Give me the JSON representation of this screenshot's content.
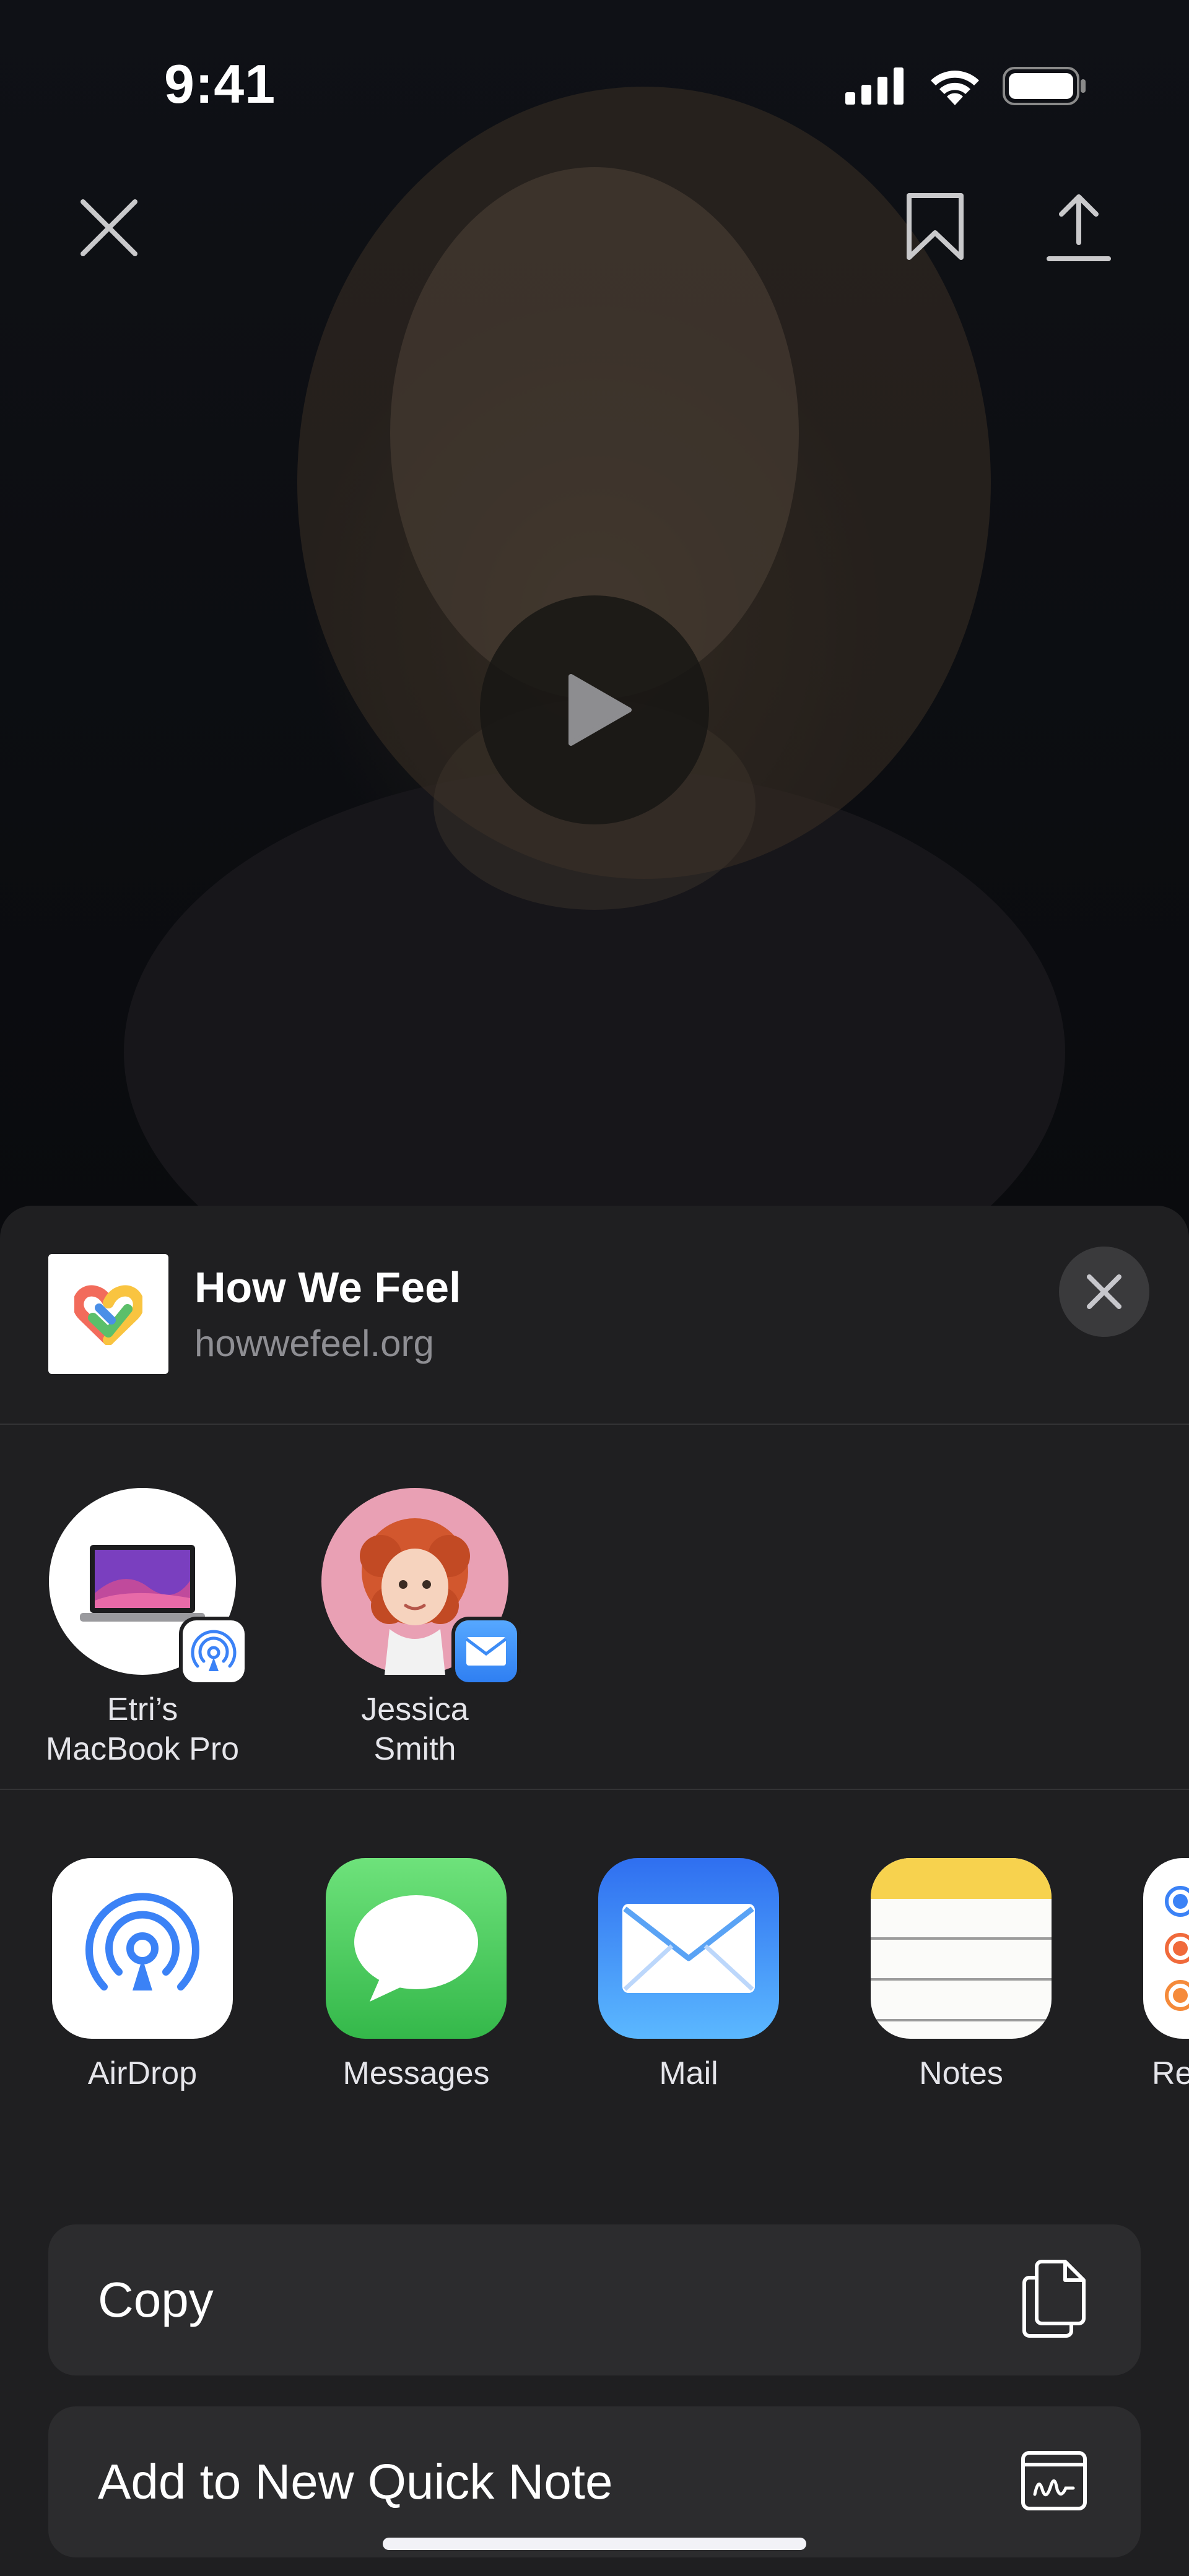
{
  "status_bar": {
    "time": "9:41"
  },
  "video": {
    "close_icon": "close-icon",
    "bookmark_icon": "bookmark-icon",
    "share_icon": "share-icon",
    "play_icon": "play-icon"
  },
  "share_sheet": {
    "title": "How We Feel",
    "subtitle": "howwefeel.org",
    "people": [
      {
        "name": "Etri’s\nMacBook Pro",
        "badge_icon": "airdrop-icon"
      },
      {
        "name": "Jessica\nSmith",
        "badge_icon": "mail-icon"
      }
    ],
    "apps": [
      {
        "label": "AirDrop"
      },
      {
        "label": "Messages"
      },
      {
        "label": "Mail"
      },
      {
        "label": "Notes"
      },
      {
        "label": "Re"
      }
    ],
    "actions": [
      {
        "label": "Copy",
        "icon": "copy-icon"
      },
      {
        "label": "Add to New Quick Note",
        "icon": "quick-note-icon"
      }
    ]
  },
  "colors": {
    "sheet_bg": "#1f1f21",
    "action_bg": "#2c2c2e",
    "secondary_text": "#8e8e93",
    "airdrop_blue": "#3b82f6",
    "messages_green": "#4cd964",
    "mail_blue": "#3d8cf5",
    "notes_yellow": "#f7d24e"
  }
}
